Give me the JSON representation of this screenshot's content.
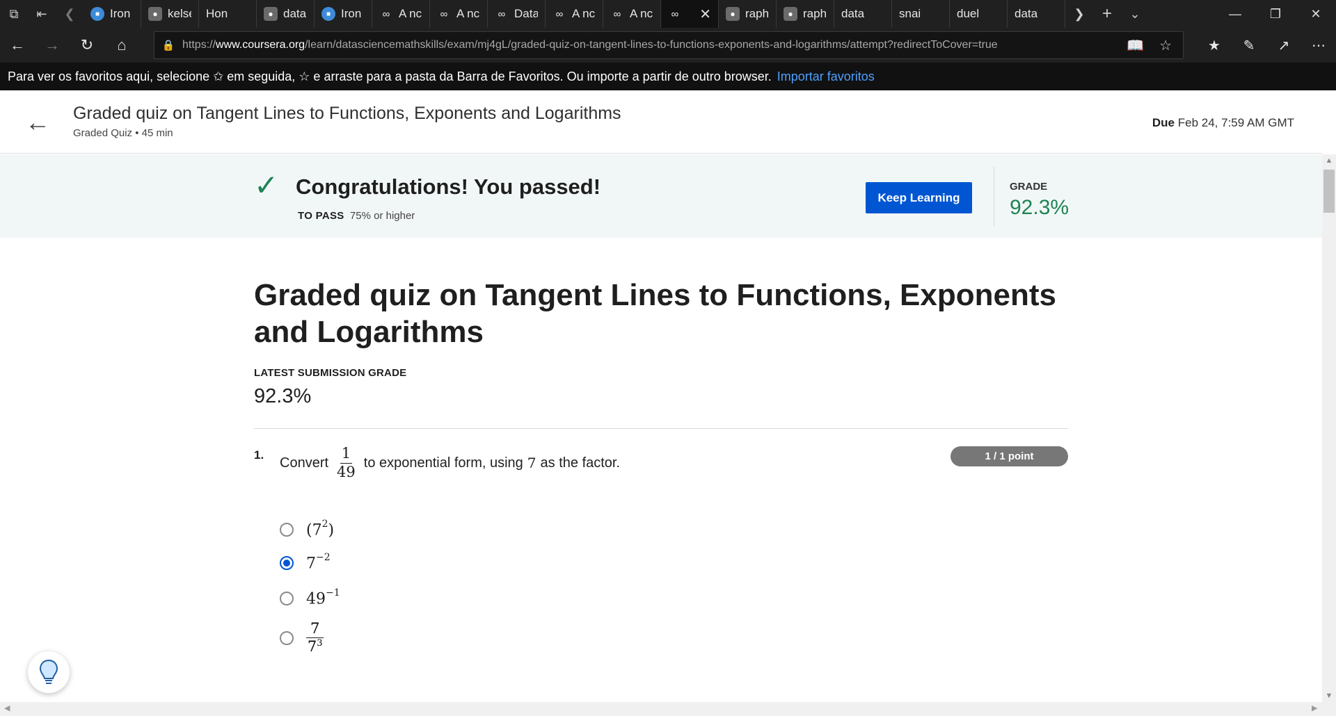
{
  "browser": {
    "tabs": [
      {
        "label": "Iron",
        "icon": "blue"
      },
      {
        "label": "kelsé",
        "icon": "gh"
      },
      {
        "label": "Hon",
        "icon": "page"
      },
      {
        "label": "data",
        "icon": "gh"
      },
      {
        "label": "Iron",
        "icon": "blue"
      },
      {
        "label": "A nc",
        "icon": "inf"
      },
      {
        "label": "A nc",
        "icon": "inf"
      },
      {
        "label": "Data",
        "icon": "inf"
      },
      {
        "label": "A nc",
        "icon": "inf"
      },
      {
        "label": "A nc",
        "icon": "inf"
      },
      {
        "label": "",
        "icon": "inf",
        "active": true
      },
      {
        "label": "raph",
        "icon": "gh"
      },
      {
        "label": "raph",
        "icon": "gh"
      },
      {
        "label": "data",
        "icon": "page"
      },
      {
        "label": "snai",
        "icon": "page"
      },
      {
        "label": "duel",
        "icon": "page"
      },
      {
        "label": "data",
        "icon": "page"
      }
    ],
    "url_prefix": "https://",
    "url_host": "www.coursera.org",
    "url_path": "/learn/datasciencemathskills/exam/mj4gL/graded-quiz-on-tangent-lines-to-functions-exponents-and-logarithms/attempt?redirectToCover=true",
    "favbar_text": "Para ver os favoritos aqui, selecione ✩ em seguida, ☆ e arraste para a pasta da Barra de Favoritos. Ou importe a partir de outro browser.",
    "favbar_link": "Importar favoritos"
  },
  "header": {
    "title": "Graded quiz on Tangent Lines to Functions, Exponents and Logarithms",
    "subtitle": "Graded Quiz • 45 min",
    "due_label": "Due",
    "due_value": "Feb 24, 7:59 AM GMT"
  },
  "banner": {
    "message": "Congratulations! You passed!",
    "to_pass_label": "TO PASS",
    "to_pass_value": "75% or higher",
    "button": "Keep Learning",
    "grade_label": "GRADE",
    "grade_value": "92.3%"
  },
  "quiz": {
    "title": "Graded quiz on Tangent Lines to Functions, Exponents and Logarithms",
    "latest_label": "LATEST SUBMISSION GRADE",
    "latest_value": "92.3%"
  },
  "question1": {
    "number": "1.",
    "text_before": "Convert",
    "frac_num": "1",
    "frac_den": "49",
    "text_mid": "to exponential form, using",
    "factor": "7",
    "text_after": "as the factor.",
    "points": "1 / 1 point",
    "options": [
      {
        "base": "(7",
        "exp": "2",
        "tail": ")",
        "selected": false
      },
      {
        "base": "7",
        "exp": "−2",
        "tail": "",
        "selected": true
      },
      {
        "base": "49",
        "exp": "−1",
        "tail": "",
        "selected": false
      },
      {
        "num": "7",
        "den_base": "7",
        "den_exp": "3",
        "selected": false
      }
    ]
  },
  "colors": {
    "accent": "#0056d2",
    "success": "#1f8354",
    "banner_bg": "#f1f7f6"
  }
}
